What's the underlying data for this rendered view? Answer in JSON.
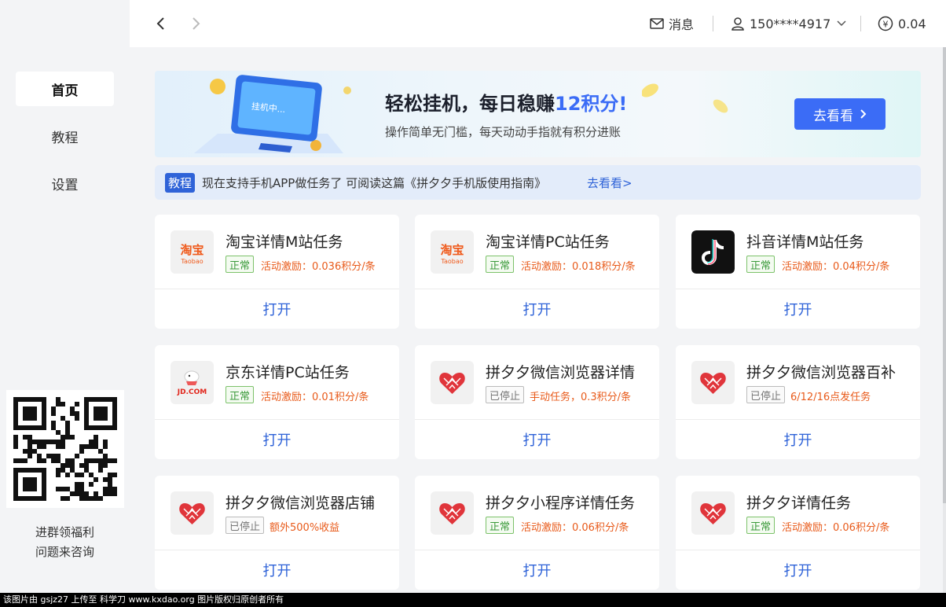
{
  "sidebar": {
    "items": [
      {
        "label": "首页",
        "active": true
      },
      {
        "label": "教程",
        "active": false
      },
      {
        "label": "设置",
        "active": false
      }
    ],
    "qr_note_line1": "进群领福利",
    "qr_note_line2": "问题来咨询"
  },
  "header": {
    "back_icon": "chevron-left-icon",
    "forward_icon": "chevron-right-icon",
    "messages_label": "消息",
    "account_label": "150****4917",
    "balance_label": "0.04"
  },
  "banner": {
    "title_prefix": "轻松挂机，每日稳赚",
    "title_highlight": "12积分!",
    "subtitle": "操作简单无门槛，每天动动手指就有积分进账",
    "illustration_label": "挂机中...",
    "button_label": "去看看"
  },
  "notice": {
    "tag": "教程",
    "text": "现在支持手机APP做任务了 可阅读这篇《拼夕夕手机版使用指南》",
    "link": "去看看>"
  },
  "tasks": [
    {
      "title": "淘宝详情M站任务",
      "status": "正常",
      "status_type": "ok",
      "incentive": "活动激励：0.036积分/条",
      "logo": "taobao",
      "open_label": "打开"
    },
    {
      "title": "淘宝详情PC站任务",
      "status": "正常",
      "status_type": "ok",
      "incentive": "活动激励：0.018积分/条",
      "logo": "taobao",
      "open_label": "打开"
    },
    {
      "title": "抖音详情M站任务",
      "status": "正常",
      "status_type": "ok",
      "incentive": "活动激励：0.04积分/条",
      "logo": "douyin",
      "open_label": "打开"
    },
    {
      "title": "京东详情PC站任务",
      "status": "正常",
      "status_type": "ok",
      "incentive": "活动激励：0.01积分/条",
      "logo": "jd",
      "open_label": "打开"
    },
    {
      "title": "拼夕夕微信浏览器详情",
      "status": "已停止",
      "status_type": "stop",
      "incentive": "手动任务，0.3积分/条",
      "logo": "pdd",
      "open_label": "打开"
    },
    {
      "title": "拼夕夕微信浏览器百补",
      "status": "已停止",
      "status_type": "stop",
      "incentive": "6/12/16点发任务",
      "logo": "pdd",
      "open_label": "打开"
    },
    {
      "title": "拼夕夕微信浏览器店铺",
      "status": "已停止",
      "status_type": "stop",
      "incentive": "额外500%收益",
      "logo": "pdd",
      "open_label": "打开"
    },
    {
      "title": "拼夕夕小程序详情任务",
      "status": "正常",
      "status_type": "ok",
      "incentive": "活动激励：0.06积分/条",
      "logo": "pdd",
      "open_label": "打开"
    },
    {
      "title": "拼夕夕详情任务",
      "status": "正常",
      "status_type": "ok",
      "incentive": "活动激励：0.06积分/条",
      "logo": "pdd",
      "open_label": "打开"
    }
  ],
  "logo_text": {
    "taobao_cn": "淘宝",
    "taobao_en": "Taobao",
    "jd": "JD.COM"
  },
  "footer": {
    "text": "该图片由 gsjz27 上传至 科学刀 www.kxdao.org 图片版权归原创者所有"
  },
  "colors": {
    "accent": "#3b6cf6",
    "link": "#2f63d8",
    "incentive": "#e85a1a",
    "status_ok": "#3a9a3a",
    "pdd_red": "#e0353b"
  }
}
